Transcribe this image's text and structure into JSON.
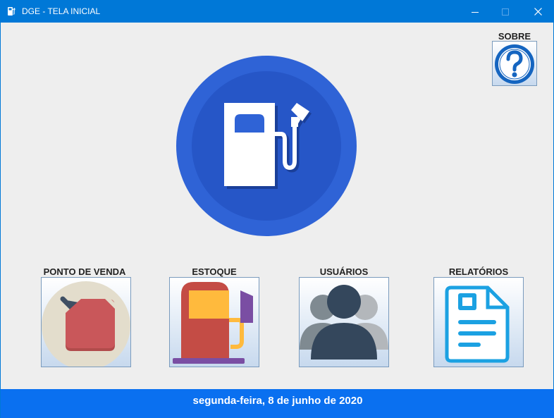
{
  "window": {
    "title": "DGE - TELA INICIAL",
    "controls": {
      "minimize_icon": "minimize-icon",
      "maximize_icon": "maximize-icon",
      "close_icon": "close-icon"
    }
  },
  "about": {
    "label": "SOBRE",
    "icon": "question-mark-icon"
  },
  "logo": {
    "icon": "fuel-pump-logo"
  },
  "menu": [
    {
      "label": "PONTO DE VENDA",
      "icon": "fuel-can-icon"
    },
    {
      "label": "ESTOQUE",
      "icon": "fuel-pump-icon"
    },
    {
      "label": "USUÁRIOS",
      "icon": "users-icon"
    },
    {
      "label": "RELATÓRIOS",
      "icon": "document-icon"
    }
  ],
  "status": {
    "date": "segunda-feira, 8 de junho de 2020"
  },
  "colors": {
    "titlebar": "#0078d7",
    "statusbar": "#0a70f0",
    "logo_blue": "#2f63d6",
    "background": "#eeeeee"
  }
}
